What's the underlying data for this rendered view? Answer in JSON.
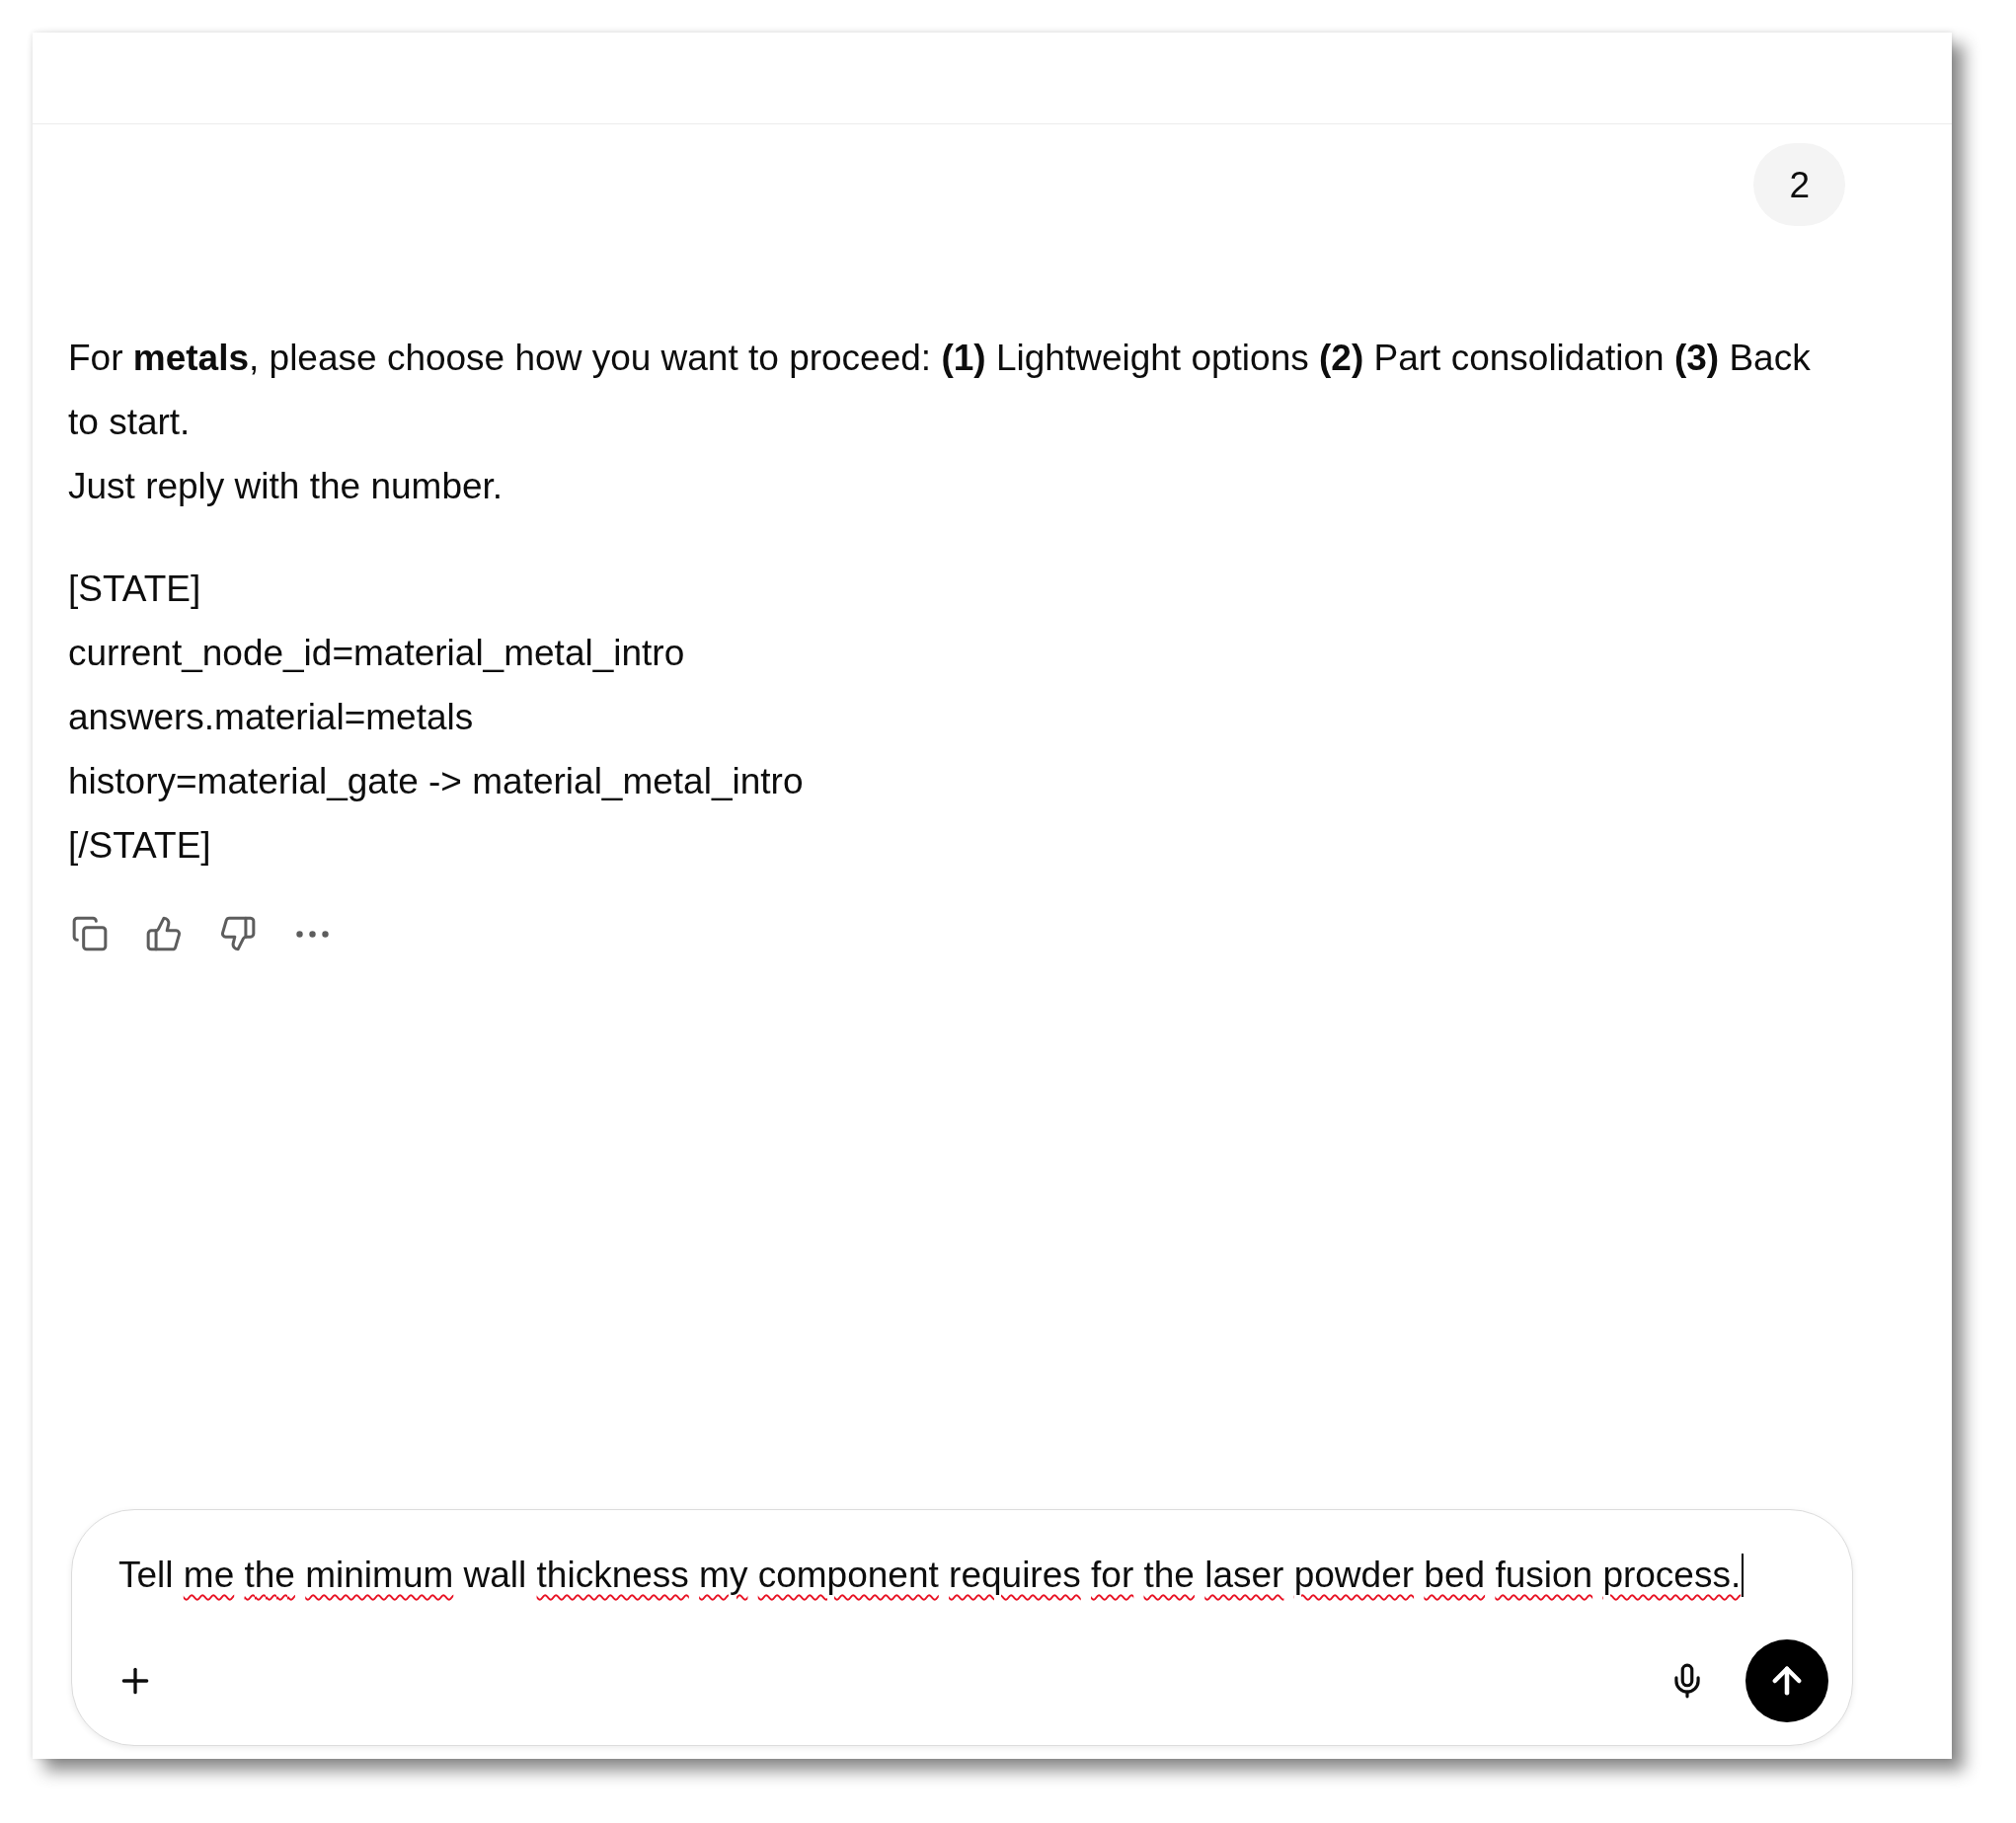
{
  "user_message": {
    "text": "2"
  },
  "assistant_message": {
    "paragraphs": [
      "For **metals**, please choose how you want to proceed: **(1)** Lightweight options **(2)** Part consolidation **(3)** Back to start.",
      "Just reply with the number."
    ],
    "state_lines": [
      "[STATE]",
      "current_node_id=material_metal_intro",
      "answers.material=metals",
      "history=material_gate -> material_metal_intro",
      "[/STATE]"
    ]
  },
  "composer": {
    "words": [
      {
        "text": "Tell",
        "misspelled": false
      },
      {
        "text": "me",
        "misspelled": true
      },
      {
        "text": "the",
        "misspelled": true
      },
      {
        "text": "minimum",
        "misspelled": true
      },
      {
        "text": "wall",
        "misspelled": false
      },
      {
        "text": "thickness",
        "misspelled": true
      },
      {
        "text": "my",
        "misspelled": true
      },
      {
        "text": "component",
        "misspelled": true
      },
      {
        "text": "requires",
        "misspelled": true
      },
      {
        "text": "for",
        "misspelled": true
      },
      {
        "text": "the",
        "misspelled": true
      },
      {
        "text": "laser",
        "misspelled": true
      },
      {
        "text": "powder",
        "misspelled": true
      },
      {
        "text": "bed",
        "misspelled": true
      },
      {
        "text": "fusion",
        "misspelled": true
      },
      {
        "text": "process.",
        "misspelled": true
      }
    ],
    "focused": true
  }
}
